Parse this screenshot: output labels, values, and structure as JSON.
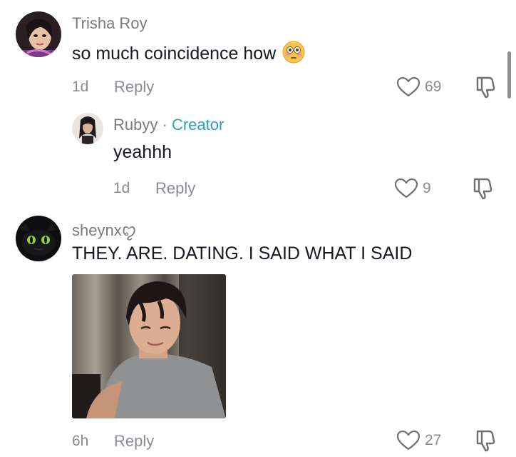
{
  "comments": [
    {
      "author": "Trisha Roy",
      "text": "so much coincidence how",
      "emoji": "flushed-face-emoji",
      "time": "1d",
      "reply_label": "Reply",
      "likes": "69"
    },
    {
      "author": "Rubyy",
      "separator": "·",
      "badge": "Creator",
      "text": "yeahhh",
      "time": "1d",
      "reply_label": "Reply",
      "likes": "9"
    },
    {
      "author": "sheynx",
      "author_suffix": "ꨄ",
      "text": "THEY. ARE. DATING. I SAID WHAT I SAID",
      "time": "6h",
      "reply_label": "Reply",
      "likes": "27"
    }
  ],
  "colors": {
    "creator_badge": "#2a9fc7",
    "meta_gray": "#8a8b91",
    "text_dark": "#161823"
  }
}
